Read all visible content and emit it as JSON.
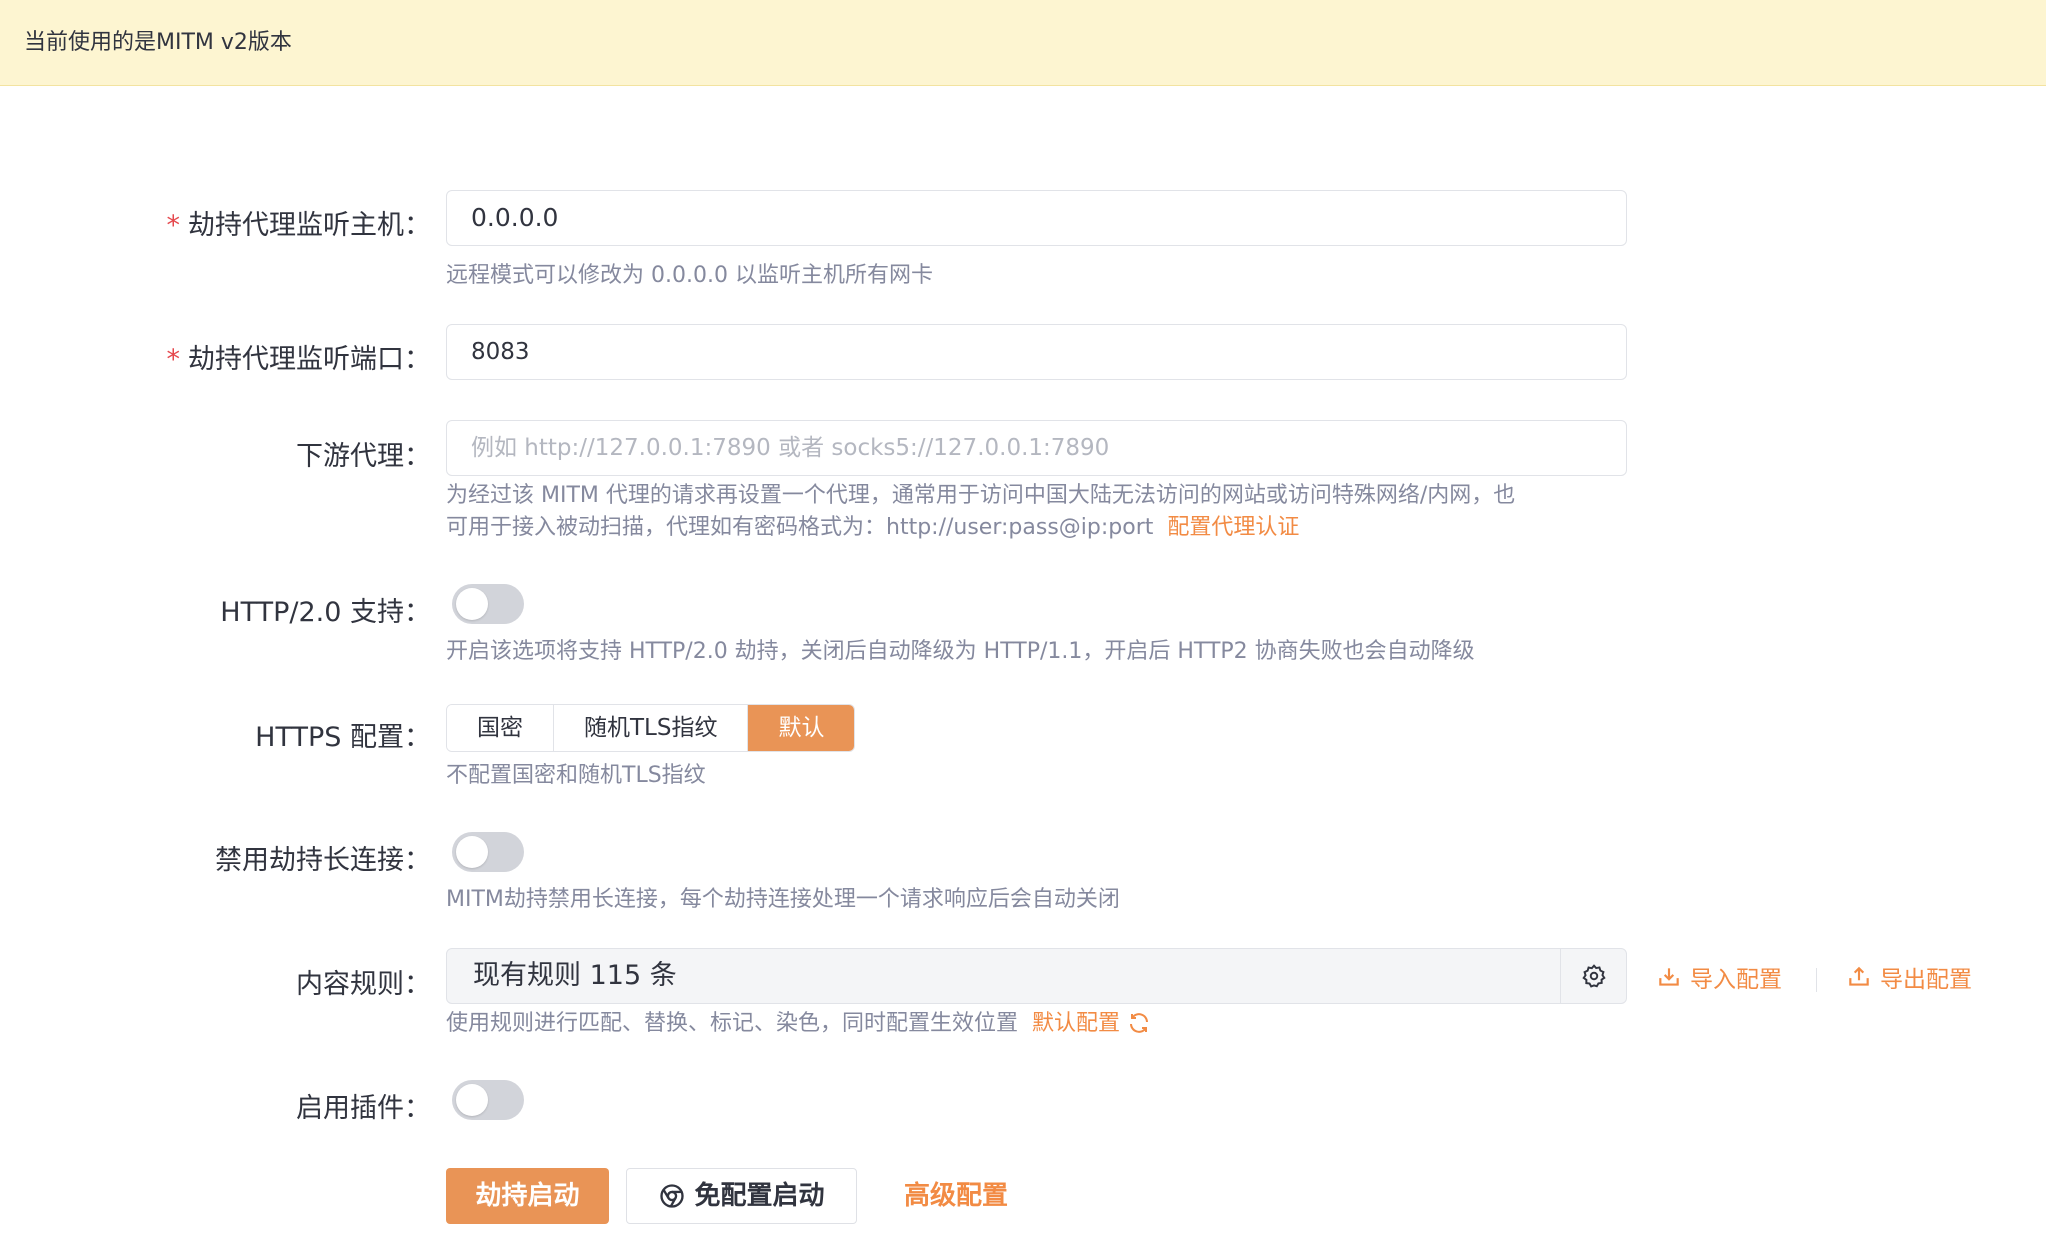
{
  "banner": {
    "text": "当前使用的是MITM v2版本"
  },
  "form": {
    "host": {
      "label": "劫持代理监听主机：",
      "value": "0.0.0.0",
      "help": "远程模式可以修改为 0.0.0.0 以监听主机所有网卡"
    },
    "port": {
      "label": "劫持代理监听端口：",
      "value": "8083"
    },
    "downstream": {
      "label": "下游代理：",
      "placeholder": "例如 http://127.0.0.1:7890 或者 socks5://127.0.0.1:7890",
      "help_line1": "为经过该 MITM 代理的请求再设置一个代理，通常用于访问中国大陆无法访问的网站或访问特殊网络/内网，也",
      "help_line2": "可用于接入被动扫描，代理如有密码格式为：http://user:pass@ip:port",
      "auth_link": "配置代理认证"
    },
    "http2": {
      "label": "HTTP/2.0 支持：",
      "enabled": false,
      "help": "开启该选项将支持 HTTP/2.0 劫持，关闭后自动降级为 HTTP/1.1，开启后 HTTP2 协商失败也会自动降级"
    },
    "https": {
      "label": "HTTPS 配置：",
      "options": [
        "国密",
        "随机TLS指纹",
        "默认"
      ],
      "selected": "默认",
      "help": "不配置国密和随机TLS指纹"
    },
    "keepalive": {
      "label": "禁用劫持长连接：",
      "enabled": false,
      "help": "MITM劫持禁用长连接，每个劫持连接处理一个请求响应后会自动关闭"
    },
    "rules": {
      "label": "内容规则：",
      "summary": "现有规则 115 条",
      "import": "导入配置",
      "export": "导出配置",
      "help": "使用规则进行匹配、替换、标记、染色，同时配置生效位置",
      "default_link": "默认配置"
    },
    "plugins": {
      "label": "启用插件：",
      "enabled": false
    }
  },
  "actions": {
    "start": "劫持启动",
    "start_no_config": "免配置启动",
    "advanced": "高级配置"
  },
  "colors": {
    "accent": "#e99456",
    "link": "#f28b44",
    "required": "#e5484d"
  }
}
